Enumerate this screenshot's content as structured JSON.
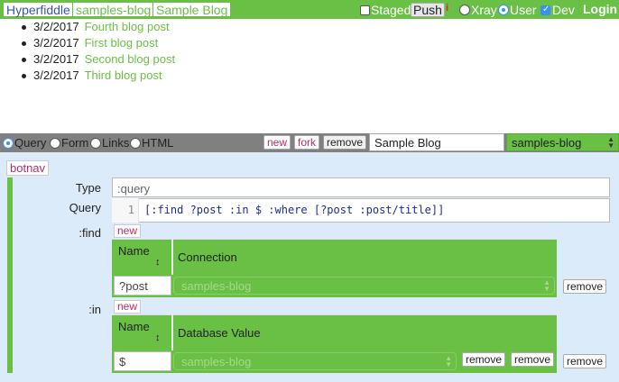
{
  "topbar": {
    "breadcrumbs": [
      "Hyperfiddle",
      "samples-blog",
      "Sample Blog"
    ],
    "staged_label": "Staged",
    "push_label": "Push",
    "info_glyph": "i",
    "xray_label": "Xray",
    "user_label": "User",
    "dev_label": "Dev",
    "login_label": "Login",
    "staged_checked": false,
    "dev_checked": true,
    "mode_selected": "User"
  },
  "posts": [
    {
      "date": "3/2/2017",
      "title": "Fourth blog post"
    },
    {
      "date": "3/2/2017",
      "title": "First blog post"
    },
    {
      "date": "3/2/2017",
      "title": "Second blog post"
    },
    {
      "date": "3/2/2017",
      "title": "Third blog post"
    }
  ],
  "editor": {
    "modes": [
      "Query",
      "Form",
      "Links",
      "HTML"
    ],
    "mode_selected": "Query",
    "new_label": "new",
    "fork_label": "fork",
    "remove_label": "remove",
    "fiddle_name": "Sample Blog",
    "connection": "samples-blog",
    "botnav_label": "botnav",
    "type_label": "Type",
    "type_value": ":query",
    "query_label": "Query",
    "query_line_number": "1",
    "query_code": "[:find ?post :in $ :where [?post :post/title]]",
    "find_label": ":find",
    "find_new_label": "new",
    "find_table": {
      "col_name": "Name",
      "col_value": "Connection",
      "sort_glyph": "↕",
      "rows": [
        {
          "name": "?post",
          "value": "samples-blog",
          "remove": "remove"
        }
      ]
    },
    "in_label": ":in",
    "in_new_label": "new",
    "in_table": {
      "col_name": "Name",
      "col_value": "Database Value",
      "sort_glyph": "↕",
      "rows": [
        {
          "name": "$",
          "value": "samples-blog",
          "remove1": "remove",
          "remove2": "remove",
          "remove3": "remove"
        }
      ]
    }
  }
}
